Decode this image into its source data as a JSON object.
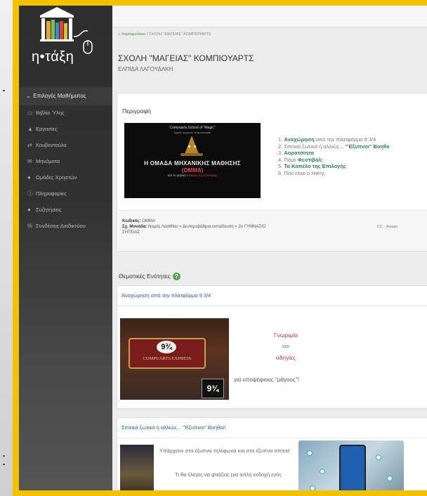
{
  "app": {
    "logo_text": "η•τάξη"
  },
  "sidebar": {
    "section": "Επιλογές Μαθήματος",
    "items": [
      {
        "label": "Βιβλίο Ύλης",
        "icon": "book-icon"
      },
      {
        "label": "Εργασίες",
        "icon": "flask-icon"
      },
      {
        "label": "Κουβεντούλα",
        "icon": "exchange-icon"
      },
      {
        "label": "Μηνύματα",
        "icon": "envelope-icon"
      },
      {
        "label": "Ομάδες Χρηστών",
        "icon": "users-icon"
      },
      {
        "label": "Πληροφορίες",
        "icon": "info-icon"
      },
      {
        "label": "Συζητήσεις",
        "icon": "comments-icon"
      },
      {
        "label": "Συνδέσεις Διαδικτύου",
        "icon": "link-icon"
      }
    ]
  },
  "breadcrumb": {
    "home": "Χαρτοφυλάκιο",
    "separator": "/",
    "current": "ΣΧΟΛΗ \"ΜΑΓΕΙΑΣ\" ΚΟΜΠΙΟΥΑΡΤΣ"
  },
  "course": {
    "title": "ΣΧΟΛΗ \"ΜΑΓΕΙΑΣ\" ΚΟΜΠΙΟΥΑΡΤΣ",
    "author": "ΕΛΠΙΔΑ ΛΑΓΟΥΔΑΚΗ"
  },
  "description": {
    "title": "Περιγραφή",
    "banner": {
      "line1": "Compuarts School of \"Magic\"",
      "line2": "Σχολή \"μαγείας\" Κόμπιουαρτς",
      "line3": "Η ΟΜΑΔΑ ΜΗΧΑΝΙΚΗΣ ΜΑΘΗΣΗΣ",
      "line4": "(ΟΜΜΑ)",
      "line5_prefix": "και το μαγικό",
      "line5_highlight": "Καπέλο της Επιλογής"
    },
    "toc": [
      {
        "num": "1. ",
        "bold": "Αναχώρηση",
        "rest": " από την πλατφόρμα 9 3/4"
      },
      {
        "num": "2. ",
        "bold": "",
        "rest": "Σπιτικά ξωτικά ή αλλιώς... ",
        "bold2": "\"Έξυπνοι\" Βοηθο"
      },
      {
        "num": "3. ",
        "bold": "Αορατότητα",
        "rest": ""
      },
      {
        "num": "4. ",
        "bold": "",
        "rest": "Πάμε ",
        "bold2": "Φεστιβάλ;"
      },
      {
        "num": "5. ",
        "bold": "Το Καπέλο της Επιλογής",
        "rest": ""
      },
      {
        "num": "6. ",
        "bold": "",
        "rest": "Πού είναι ο Harry;"
      }
    ],
    "meta": {
      "code_label": "Κωδικός:",
      "code_value": "OMMA",
      "school_label": "Σχ. Μονάδα:",
      "school_value": "Νομός Λασιθίου » Δευτεροβάθμια εκπαίδευση » 2ο ΓΥΜΝΑΣΙΟ",
      "school_value2": "ΣΗΤΕΙΑΣ",
      "license": "CC - Αναφο"
    }
  },
  "units": {
    "title": "Θεματικές Ενότητες",
    "unit1": {
      "title": "Αναχώρηση από την πλατφόρμα 9 3/4",
      "sign_num": "9¾",
      "sign_text": "COMPUARTS EXPRESS",
      "plate": "9¾",
      "text1": "Γνωριμία",
      "text2": "και",
      "text3": "οδηγίες",
      "caption": "για υποψήφιους \"μάγους\"!"
    },
    "unit2": {
      "title": "Σπιτικά ξωτικά ή αλλιώς... \"Έξυπνοι\" Βοηθοί!",
      "text1": "Υπάρχουν στα έξυπνα τηλέφωνα και στα έξυπνα σπίτια!",
      "text2": "Τι θα έλεγες να φτιάξεις μια απλή εκδοχή ενός"
    }
  },
  "colors": {
    "frame": "#f2c100",
    "sidebar": "#2e2e2e",
    "link": "#2c7b5c",
    "accent_red": "#b8343a"
  }
}
